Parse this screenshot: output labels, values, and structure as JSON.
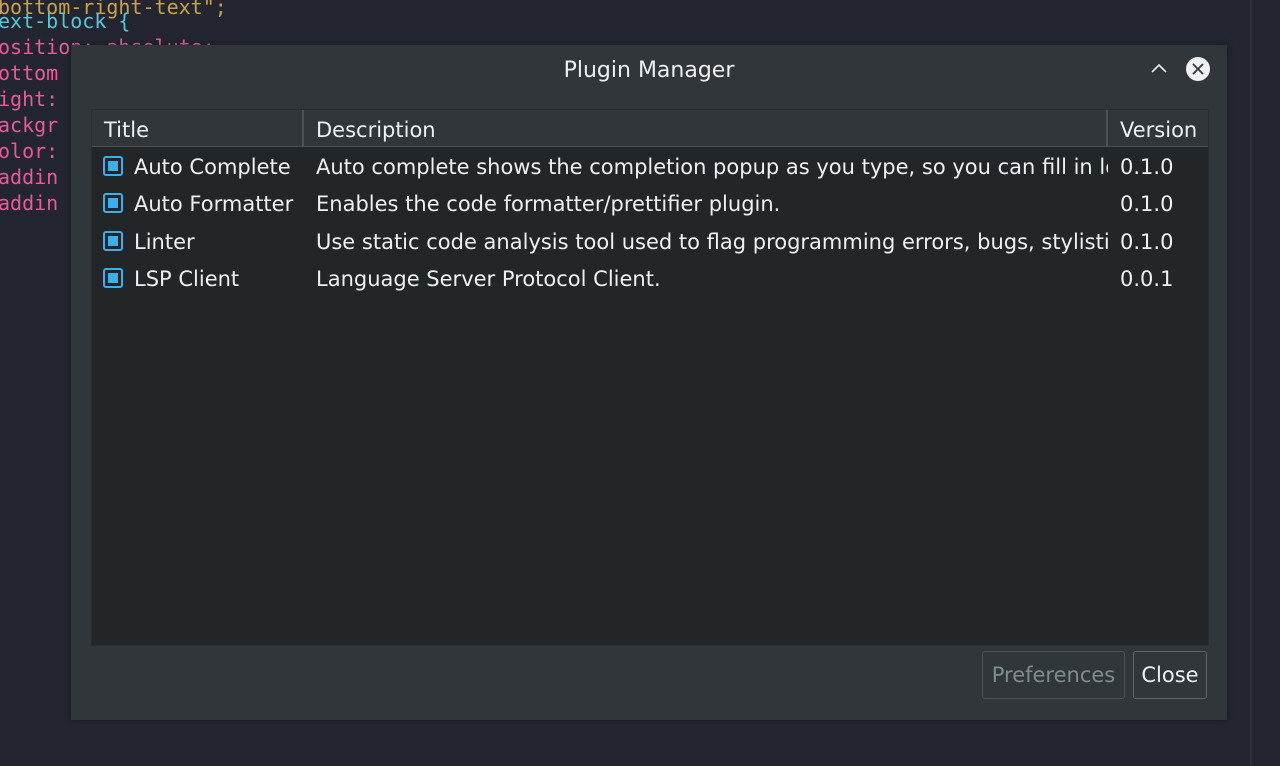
{
  "editor": {
    "lines": [
      {
        "text": "bottom-right-text\";",
        "color": "#c9a24a"
      },
      {
        "text": "ext-block {",
        "color": "#56c7d6"
      },
      {
        "text": "osition: absolute;",
        "color": "#e85a9b"
      },
      {
        "text": "ottom",
        "color": "#e85a9b"
      },
      {
        "text": "ight:",
        "color": "#e85a9b"
      },
      {
        "text": "ackgr",
        "color": "#e85a9b"
      },
      {
        "text": "olor:",
        "color": "#e85a9b"
      },
      {
        "text": "addin",
        "color": "#e85a9b"
      },
      {
        "text": "addin",
        "color": "#e85a9b"
      }
    ]
  },
  "dialog": {
    "title": "Plugin Manager",
    "minimize_icon": "chevron-up-icon",
    "close_icon": "close-circle-icon"
  },
  "table": {
    "columns": [
      "Title",
      "Description",
      "Version"
    ],
    "rows": [
      {
        "checked": true,
        "title": "Auto Complete",
        "description": "Auto complete shows the completion popup as you type, so you can fill in long words by",
        "version": "0.1.0"
      },
      {
        "checked": true,
        "title": "Auto Formatter",
        "description": "Enables the code formatter/prettifier plugin.",
        "version": "0.1.0"
      },
      {
        "checked": true,
        "title": "Linter",
        "description": "Use static code analysis tool used to flag programming errors, bugs, stylistic errors",
        "version": "0.1.0"
      },
      {
        "checked": true,
        "title": "LSP Client",
        "description": "Language Server Protocol Client.",
        "version": "0.0.1"
      }
    ]
  },
  "buttons": {
    "preferences": "Preferences",
    "close": "Close"
  },
  "colors": {
    "accent": "#3daee9",
    "text": "#eff0f1",
    "disabled_text": "#7f8c8d"
  }
}
